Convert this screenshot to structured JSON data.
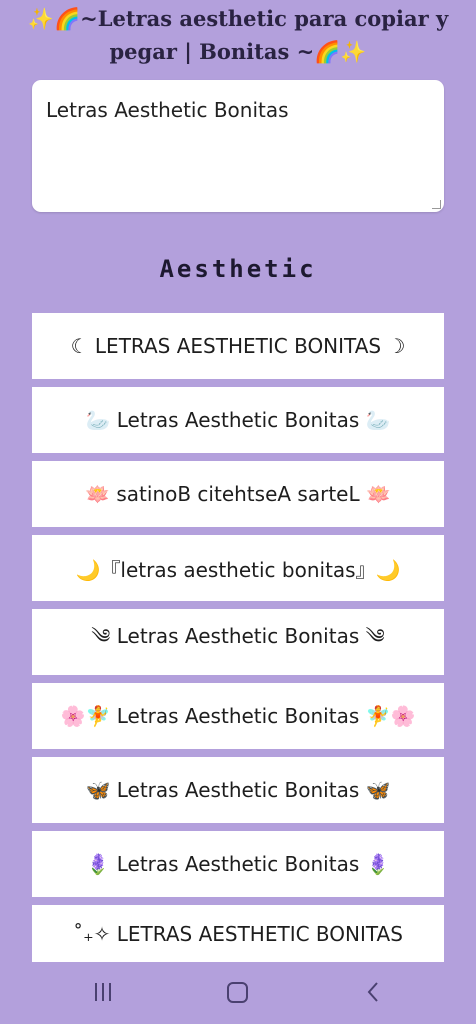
{
  "header": {
    "title": "✨🌈~Letras aesthetic para copiar y pegar | Bonitas ~🌈✨"
  },
  "input": {
    "value": "Letras Aesthetic Bonitas"
  },
  "section": {
    "title": "Aesthetic"
  },
  "styles": [
    {
      "text": "☾ LETRAS AESTHETIC BONITAS ☽"
    },
    {
      "text": "🦢 Letras Aesthetic Bonitas 🦢"
    },
    {
      "text": "🪷 satinoB citehtseA sarteL 🪷"
    },
    {
      "text": "🌙『letras aesthetic bonitas』🌙"
    },
    {
      "text": "༄ Letras Aesthetic Bonitas ༄"
    },
    {
      "text": "🌸🧚 Letras Aesthetic Bonitas 🧚🌸"
    },
    {
      "text": "🦋 Letras Aesthetic Bonitas 🦋"
    },
    {
      "text": "🪻 Letras Aesthetic Bonitas 🪻"
    },
    {
      "text": "˚₊✧ LETRAS AESTHETIC BONITAS"
    }
  ],
  "navigation": {
    "recent_icon": "recent-apps-icon",
    "home_icon": "home-icon",
    "back_icon": "back-icon"
  },
  "colors": {
    "background": "#b3a0dc",
    "card": "#ffffff",
    "text": "#1e1e1e"
  }
}
